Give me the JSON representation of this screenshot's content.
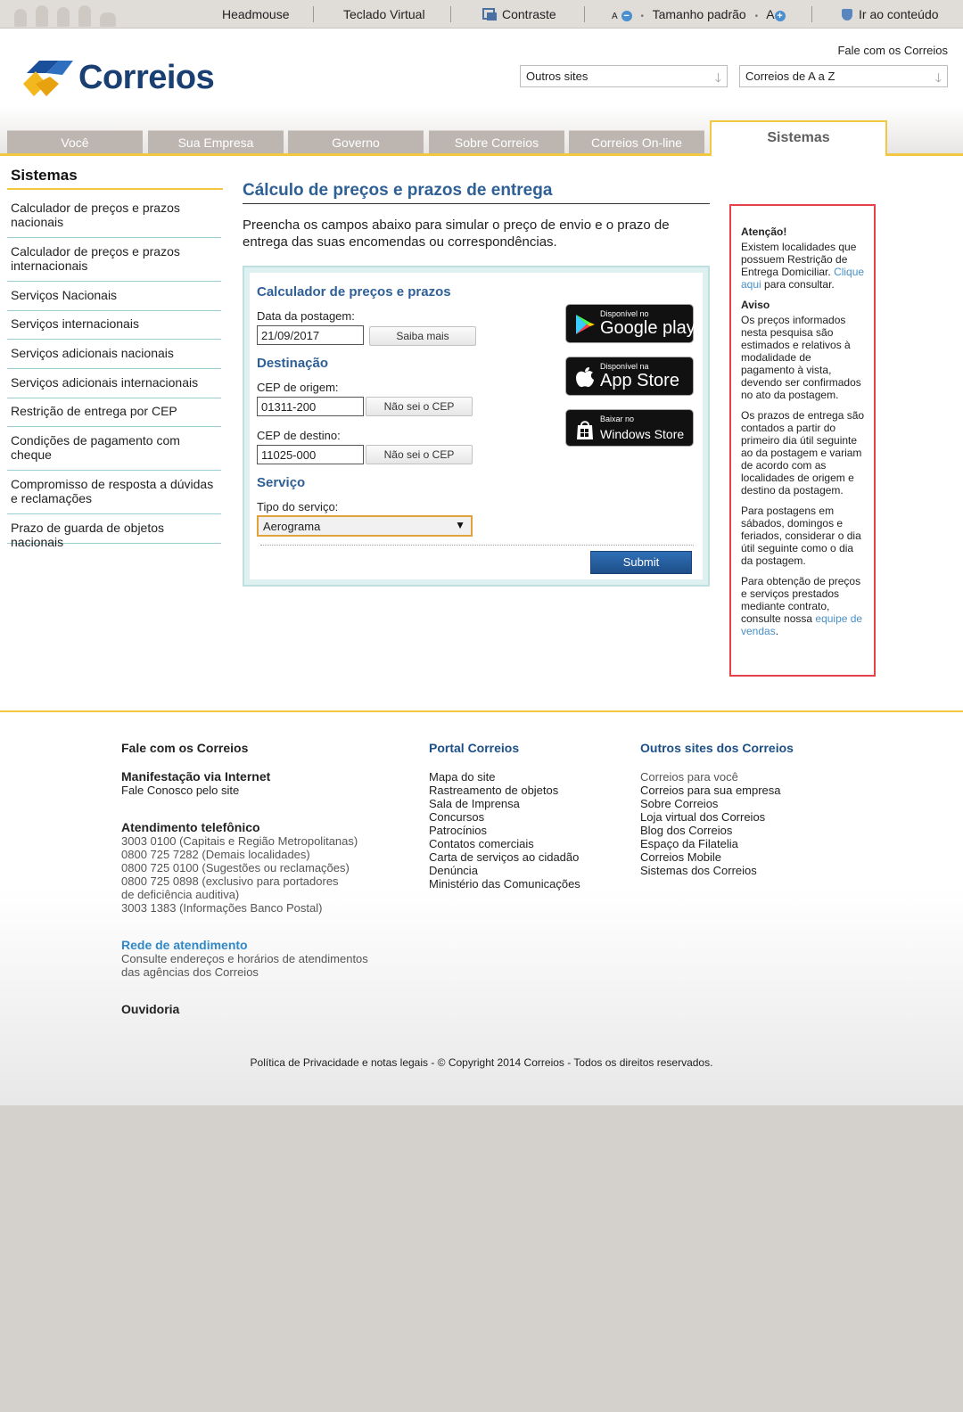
{
  "accessibility_bar": {
    "headmouse": "Headmouse",
    "teclado": "Teclado Virtual",
    "contraste": "Contraste",
    "font_small": "A",
    "minus": "−",
    "tamanho": "Tamanho padrão",
    "font_big": "A",
    "plus": "+",
    "ir_conteudo": "Ir ao conteúdo"
  },
  "header": {
    "logo_text": "Correios",
    "fale": "Fale com os Correios",
    "select_outros": "Outros sites",
    "select_az": "Correios de A a Z"
  },
  "nav": {
    "tabs": [
      "Você",
      "Sua Empresa",
      "Governo",
      "Sobre Correios",
      "Correios On-line",
      "Sistemas"
    ]
  },
  "sidebar": {
    "title": "Sistemas",
    "items": [
      "Calculador de preços e prazos nacionais",
      "Calculador de preços e prazos internacionais",
      "Serviços Nacionais",
      "Serviços internacionais",
      "Serviços adicionais nacionais",
      "Serviços adicionais internacionais",
      "Restrição de entrega por CEP",
      "Condições de pagamento com cheque",
      "Compromisso de resposta a dúvidas e reclamações",
      "Prazo de guarda de objetos nacionais"
    ]
  },
  "content": {
    "title": "Cálculo de preços e prazos de entrega",
    "intro": "Preencha os campos abaixo para simular o preço de envio e o prazo de entrega das suas encomendas ou correspondências."
  },
  "form": {
    "heading": "Calculador de preços e prazos",
    "data_label": "Data da postagem:",
    "data_value": "21/09/2017",
    "saiba_mais": "Saiba mais",
    "destino_heading": "Destinação",
    "origem_label": "CEP de origem:",
    "origem_value": "01311-200",
    "nao_sei_1": "Não sei o CEP",
    "destino_label": "CEP de destino:",
    "destino_value": "11025-000",
    "nao_sei_2": "Não sei o CEP",
    "servico_heading": "Serviço",
    "tipo_label": "Tipo do serviço:",
    "tipo_value": "Aerograma",
    "submit": "Submit"
  },
  "stores": {
    "google_small": "Disponível no",
    "google_big": "Google play",
    "apple_small": "Disponível na",
    "apple_big": "App Store",
    "windows_small": "Baixar no",
    "windows_big": "Windows Store"
  },
  "notice": {
    "atencao_title": "Atenção!",
    "atencao_text": "Existem localidades que possuem Restrição de Entrega Domiciliar.",
    "atencao_link": "Clique aqui",
    "atencao_after": " para consultar.",
    "aviso_title": "Aviso",
    "p1": "Os preços informados nesta pesquisa são estimados e relativos à modalidade de pagamento à vista, devendo ser confirmados no ato da postagem.",
    "p2": "Os prazos de entrega são contados a partir do primeiro dia útil seguinte ao da postagem e variam de acordo com as localidades de origem e destino da postagem.",
    "p3": "Para postagens em sábados, domingos e feriados, considerar o dia útil seguinte como o dia da postagem.",
    "p4": "Para obtenção de preços e serviços prestados mediante contrato, consulte nossa ",
    "p4_link": "equipe de vendas",
    "p4_end": "."
  },
  "footer": {
    "col1": {
      "title": "Fale com os Correios",
      "manif_title": "Manifestação via Internet",
      "manif_text": "Fale Conosco pelo site",
      "tel_title": "Atendimento telefônico",
      "tel_lines": [
        "3003 0100 (Capitais e Região Metropolitanas)",
        "0800 725 7282 (Demais localidades)",
        "0800 725 0100 (Sugestões ou reclamações)",
        "0800 725 0898 (exclusivo para portadores",
        "de deficiência auditiva)",
        "3003 1383 (Informações Banco Postal)"
      ],
      "rede_title": "Rede de atendimento",
      "rede_lines": [
        "Consulte endereços e horários de atendimentos",
        "das agências dos Correios"
      ],
      "ouvidoria": "Ouvidoria"
    },
    "col2": {
      "title": "Portal Correios",
      "links": [
        "Mapa do site",
        "Rastreamento de objetos",
        "Sala de Imprensa",
        "Concursos",
        "Patrocínios",
        "Contatos comerciais",
        "Carta de serviços ao cidadão",
        "Denúncia",
        "Ministério das Comunicações"
      ]
    },
    "col3": {
      "title": "Outros sites dos Correios",
      "links": [
        "Correios para você",
        "Correios para sua empresa",
        "Sobre Correios",
        "Loja virtual dos Correios",
        "Blog dos Correios",
        "Espaço da Filatelia",
        "Correios Mobile",
        "Sistemas dos Correios"
      ]
    },
    "copyright": "Política de Privacidade e notas legais - © Copyright 2014 Correios - Todos os direitos reservados."
  },
  "colors": {
    "brand_blue": "#1a3f73",
    "brand_yellow": "#f2c843",
    "heading_blue": "#2e5f95",
    "notice_border": "#e6404a"
  }
}
